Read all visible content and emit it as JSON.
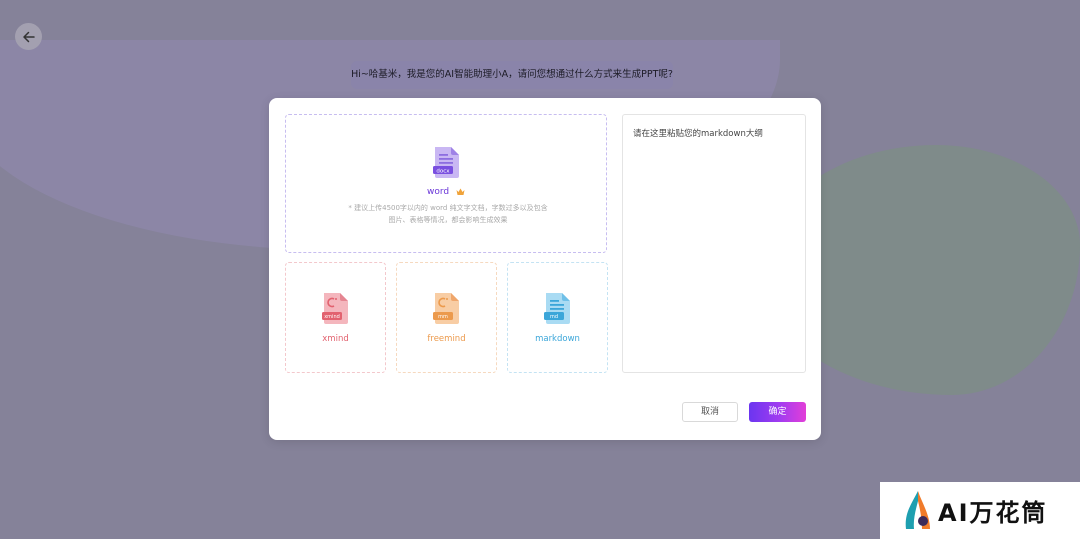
{
  "header": {
    "greeting": "Hi~哈基米，我是您的AI智能助理小A，请问您想通过什么方式来生成PPT呢?"
  },
  "icons": {
    "back": "arrow-left-icon",
    "word_file": "word-file-icon",
    "crown": "crown-icon",
    "xmind_file": "xmind-file-icon",
    "freemind_file": "freemind-file-icon",
    "markdown_file": "markdown-file-icon"
  },
  "upload": {
    "word": {
      "file_tag": "docx",
      "label": "word",
      "desc_line1": "* 建议上传4500字以内的 word 纯文字文档，字数过多以及包含",
      "desc_line2": "图片、表格等情况，都会影响生成效果"
    },
    "formats": [
      {
        "tag": "xmind",
        "label": "xmind",
        "color": "#e2626f"
      },
      {
        "tag": "mm",
        "label": "freemind",
        "color": "#ec9a4c"
      },
      {
        "tag": "md",
        "label": "markdown",
        "color": "#3ba6d9"
      }
    ]
  },
  "markdown_input": {
    "placeholder": "请在这里粘贴您的markdown大纲",
    "value": ""
  },
  "footer": {
    "cancel_label": "取消",
    "confirm_label": "确定"
  },
  "watermark": {
    "text": "AI万花筒"
  },
  "colors": {
    "brand_purple": "#6a36d8",
    "overlay": "#858299"
  }
}
